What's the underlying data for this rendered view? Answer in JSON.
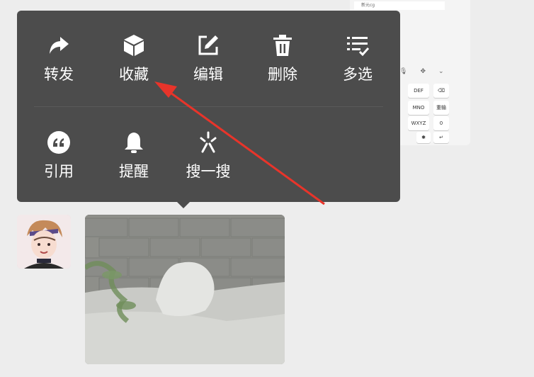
{
  "keyboard": {
    "input_text": "新元cg",
    "keys": [
      "DEF",
      "MNO",
      "WXYZ",
      "0",
      "重输"
    ]
  },
  "menu": {
    "row1": [
      {
        "label": "转发",
        "icon": "share-arrow-icon"
      },
      {
        "label": "收藏",
        "icon": "cube-icon"
      },
      {
        "label": "编辑",
        "icon": "edit-icon"
      },
      {
        "label": "删除",
        "icon": "trash-icon"
      },
      {
        "label": "多选",
        "icon": "multi-select-icon"
      }
    ],
    "row2": [
      {
        "label": "引用",
        "icon": "quote-icon"
      },
      {
        "label": "提醒",
        "icon": "bell-icon"
      },
      {
        "label": "搜一搜",
        "icon": "sparkle-search-icon"
      }
    ]
  },
  "colors": {
    "menu_bg": "#4c4c4c",
    "page_bg": "#ededed",
    "annotation_arrow": "#e8342a"
  }
}
